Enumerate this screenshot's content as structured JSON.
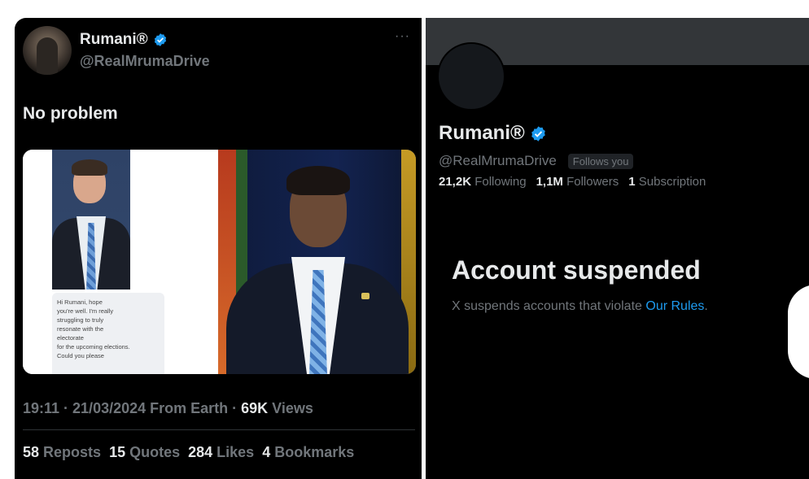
{
  "tweet": {
    "display_name": "Rumani®",
    "handle": "@RealMrumaDrive",
    "more_label": "···",
    "text": "No problem",
    "chat_lines": [
      "Hi Rumani, hope",
      "you're well. I'm really",
      "struggling to truly",
      "resonate with the",
      "electorate",
      "for the upcoming elections.",
      "Could you please"
    ],
    "time_date": "19:11 · 21/03/2024 From Earth · ",
    "views_count": "69K",
    "views_label": " Views",
    "reposts_count": "58",
    "reposts_label": " Reposts",
    "quotes_count": "15",
    "quotes_label": " Quotes",
    "likes_count": "284",
    "likes_label": " Likes",
    "bookmarks_count": "4",
    "bookmarks_label": " Bookmarks"
  },
  "profile": {
    "display_name": "Rumani®",
    "handle": "@RealMrumaDrive",
    "follows_you": "Follows you",
    "following_count": "21,2K",
    "following_label": " Following",
    "followers_count": "1,1M",
    "followers_label": " Followers",
    "subscription_count": "1",
    "subscription_label": " Subscription",
    "suspended_title": "Account suspended",
    "suspended_desc": "X suspends accounts that violate ",
    "rules_link": "Our Rules",
    "desc_end": "."
  },
  "icons": {
    "verified": "verified-badge-icon",
    "more": "more-horizontal-icon"
  },
  "colors": {
    "background": "#000000",
    "text_primary": "#e7e9ea",
    "text_secondary": "#71767b",
    "link": "#1d9bf0",
    "verified": "#1d9bf0"
  }
}
